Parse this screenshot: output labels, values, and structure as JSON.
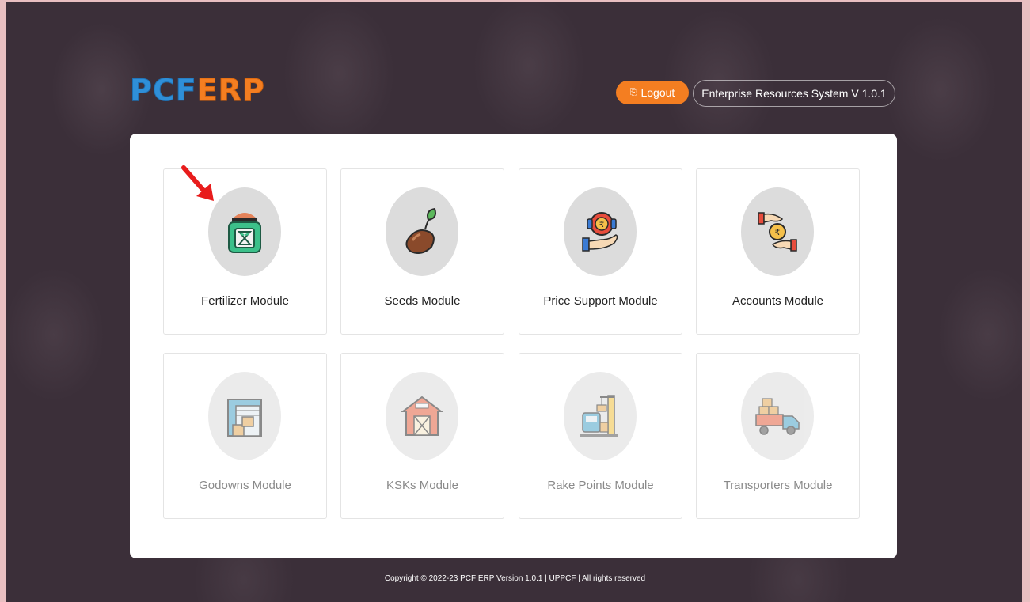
{
  "header": {
    "logo_left": "PCF",
    "logo_right": "ERP",
    "logout_label": "Logout",
    "logout_icon": "sign-out-icon",
    "system_label": "Enterprise Resources System V 1.0.1"
  },
  "modules": [
    {
      "label": "Fertilizer Module",
      "icon": "fertilizer-bag-icon",
      "enabled": true
    },
    {
      "label": "Seeds Module",
      "icon": "sprouting-seed-icon",
      "enabled": true
    },
    {
      "label": "Price Support Module",
      "icon": "rupee-support-hand-icon",
      "enabled": true
    },
    {
      "label": "Accounts Module",
      "icon": "rupee-coin-hands-icon",
      "enabled": true
    },
    {
      "label": "Godowns Module",
      "icon": "warehouse-icon",
      "enabled": false
    },
    {
      "label": "KSKs Module",
      "icon": "barn-icon",
      "enabled": false
    },
    {
      "label": "Rake Points Module",
      "icon": "train-loading-icon",
      "enabled": false
    },
    {
      "label": "Transporters Module",
      "icon": "delivery-truck-icon",
      "enabled": false
    }
  ],
  "footer": {
    "copyright": "Copyright © 2022-23 PCF ERP Version 1.0.1 | UPPCF | All rights reserved"
  },
  "colors": {
    "accent": "#f47e21",
    "brand_blue": "#2f8fd8",
    "background": "#3b2f39",
    "annotation_arrow": "#e81c1c"
  }
}
